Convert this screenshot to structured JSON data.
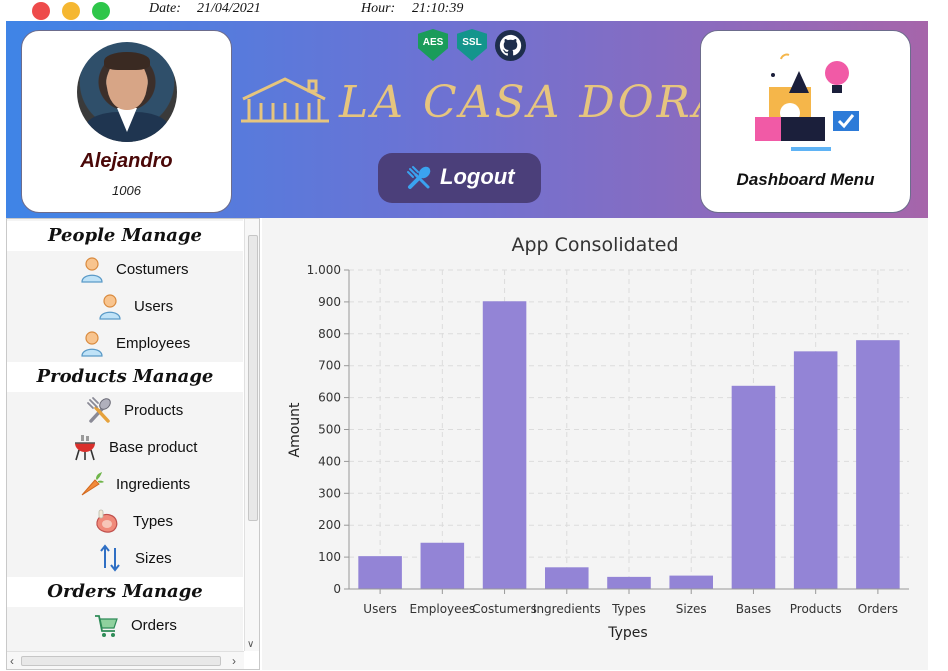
{
  "titlebar": {
    "date_label": "Date:",
    "date_value": "21/04/2021",
    "hour_label": "Hour:",
    "hour_value": "21:10:39"
  },
  "header": {
    "profile": {
      "name": "Alejandro",
      "id": "1006"
    },
    "badges": [
      "AES",
      "SSL"
    ],
    "logo_text": "LA CASA DORADA",
    "logout_label": "Logout",
    "dashboard_label": "Dashboard Menu",
    "gradient_colors": [
      "#3f84e6",
      "#a665aa"
    ]
  },
  "sidebar": {
    "sections": [
      {
        "title": "People Manage",
        "items": [
          {
            "label": "Costumers",
            "icon": "customer-person-icon"
          },
          {
            "label": "Users",
            "icon": "user-person-icon"
          },
          {
            "label": "Employees",
            "icon": "employee-person-icon"
          }
        ]
      },
      {
        "title": "Products Manage",
        "items": [
          {
            "label": "Products",
            "icon": "utensils-icon"
          },
          {
            "label": "Base product",
            "icon": "grill-icon"
          },
          {
            "label": "Ingredients",
            "icon": "carrot-icon"
          },
          {
            "label": "Types",
            "icon": "meat-icon"
          },
          {
            "label": "Sizes",
            "icon": "up-down-arrows-icon"
          }
        ]
      },
      {
        "title": "Orders Manage",
        "items": [
          {
            "label": "Orders",
            "icon": "shopping-cart-icon"
          }
        ]
      }
    ]
  },
  "chart_data": {
    "type": "bar",
    "title": "App Consolidated",
    "xlabel": "Types",
    "ylabel": "Amount",
    "categories": [
      "Users",
      "Employees",
      "Costumers",
      "Ingredients",
      "Types",
      "Sizes",
      "Bases",
      "Products",
      "Orders"
    ],
    "values": [
      103,
      145,
      902,
      68,
      38,
      42,
      637,
      745,
      780
    ],
    "ylim": [
      0,
      1000
    ],
    "yticks": [
      "0",
      "100",
      "200",
      "300",
      "400",
      "500",
      "600",
      "700",
      "800",
      "900",
      "1.000"
    ],
    "grid": true,
    "bar_color": "#9384d6"
  }
}
